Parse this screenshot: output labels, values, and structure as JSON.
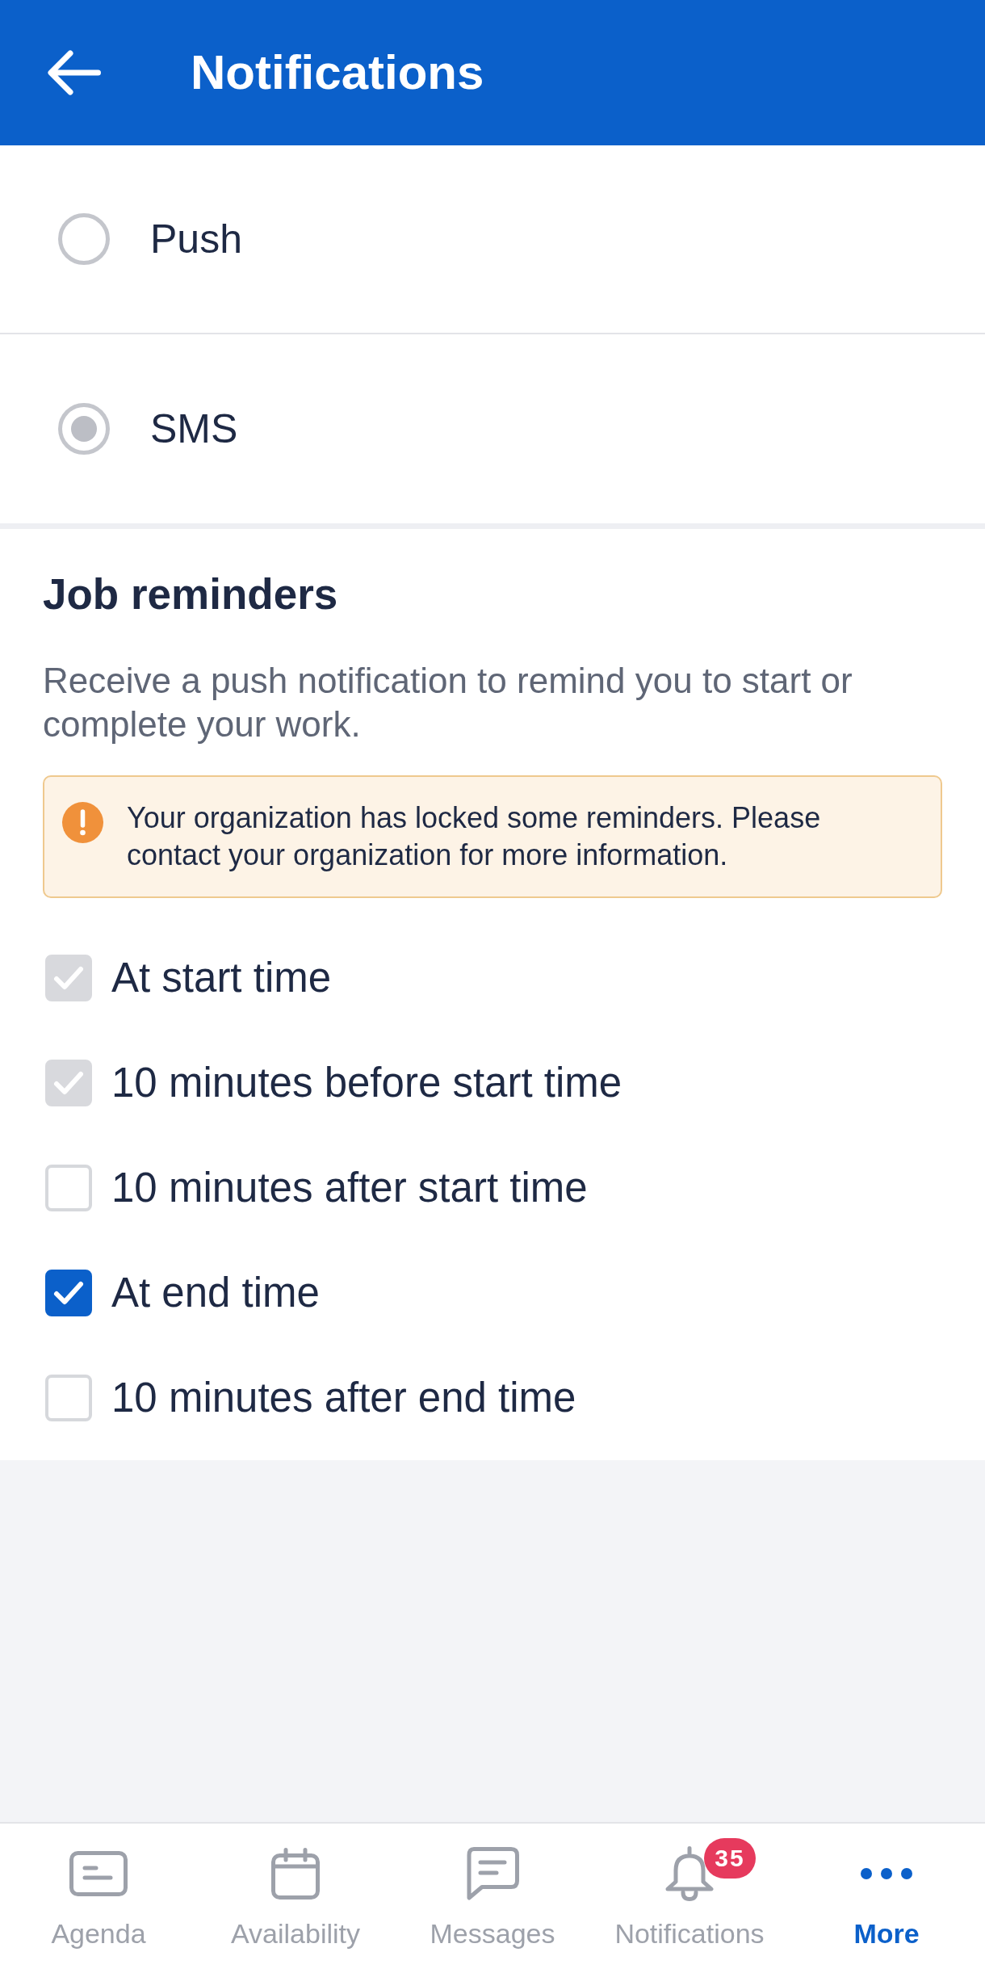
{
  "header": {
    "title": "Notifications"
  },
  "channels": [
    {
      "label": "Push",
      "selected": false
    },
    {
      "label": "SMS",
      "selected": true
    }
  ],
  "job_reminders": {
    "title": "Job reminders",
    "description": "Receive a push notification to remind you to start or complete your work.",
    "notice": "Your organization has locked some reminders. Please contact your organization for more information.",
    "options": [
      {
        "label": "At start time",
        "checked": true,
        "disabled": true
      },
      {
        "label": "10 minutes before start time",
        "checked": true,
        "disabled": true
      },
      {
        "label": "10 minutes after start time",
        "checked": false,
        "disabled": false
      },
      {
        "label": "At end time",
        "checked": true,
        "disabled": false
      },
      {
        "label": "10 minutes after end time",
        "checked": false,
        "disabled": false
      }
    ]
  },
  "nav": [
    {
      "label": "Agenda",
      "selected": false
    },
    {
      "label": "Availability",
      "selected": false
    },
    {
      "label": "Messages",
      "selected": false
    },
    {
      "label": "Notifications",
      "selected": false,
      "badge": "35"
    },
    {
      "label": "More",
      "selected": true
    }
  ]
}
